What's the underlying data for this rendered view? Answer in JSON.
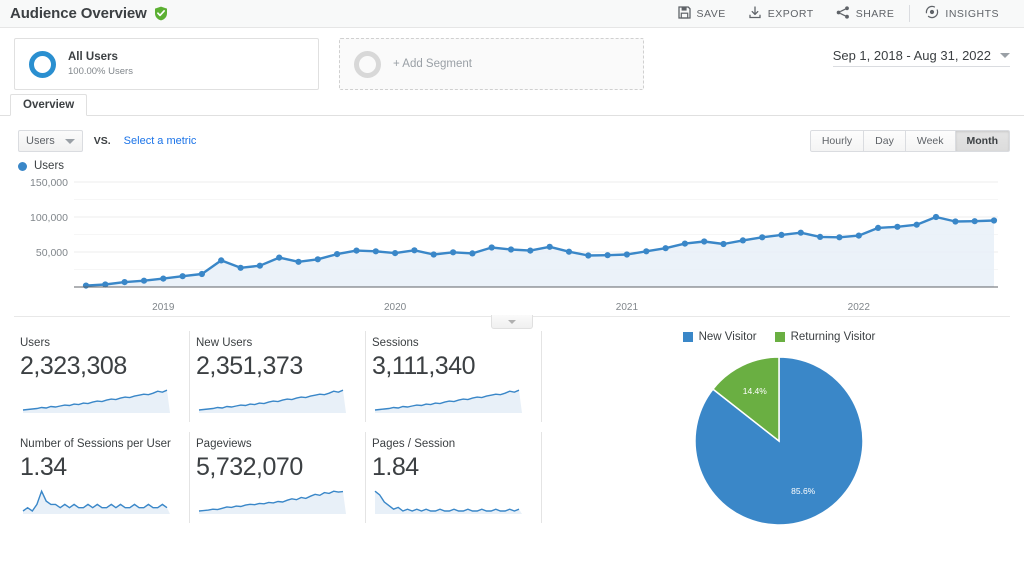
{
  "header": {
    "title": "Audience Overview",
    "verified_icon": "verified-shield-icon",
    "actions": [
      {
        "label": "SAVE",
        "icon": "save-icon"
      },
      {
        "label": "EXPORT",
        "icon": "export-download-icon"
      },
      {
        "label": "SHARE",
        "icon": "share-icon"
      },
      {
        "label": "INSIGHTS",
        "icon": "insights-icon"
      }
    ]
  },
  "segments": {
    "all_users": {
      "name": "All Users",
      "sub": "100.00% Users",
      "icon": "donut-icon"
    },
    "add_segment": {
      "label": "+ Add Segment",
      "icon": "donut-empty-icon"
    }
  },
  "date_range": {
    "value": "Sep 1, 2018 - Aug 31, 2022",
    "icon": "chevron-down-icon"
  },
  "tabs": [
    {
      "label": "Overview",
      "active": true
    }
  ],
  "controls": {
    "metric_select": {
      "value": "Users",
      "icon": "chevron-down-icon"
    },
    "vs_label": "VS.",
    "select_metric_link": "Select a metric",
    "granularity": [
      {
        "label": "Hourly",
        "active": false
      },
      {
        "label": "Day",
        "active": false
      },
      {
        "label": "Week",
        "active": false
      },
      {
        "label": "Month",
        "active": true
      }
    ]
  },
  "colors": {
    "blue": "#3a87c8",
    "green": "#6aaf42",
    "area_fill": "#e8f0f8",
    "link": "#1a73e8"
  },
  "chart_data": {
    "type": "line",
    "title": "Users",
    "legend": [
      "Users"
    ],
    "legend_position": "top-left",
    "xlabel": "",
    "ylabel": "",
    "ylim": [
      0,
      150000
    ],
    "yticks": [
      50000,
      100000,
      150000
    ],
    "ytick_labels": [
      "50,000",
      "100,000",
      "150,000"
    ],
    "grid": true,
    "xtick_labels": [
      "2019",
      "2020",
      "2021",
      "2022"
    ],
    "xtick_indices": [
      4,
      16,
      28,
      40
    ],
    "x": [
      "Sep 2018",
      "Oct 2018",
      "Nov 2018",
      "Dec 2018",
      "Jan 2019",
      "Feb 2019",
      "Mar 2019",
      "Apr 2019",
      "May 2019",
      "Jun 2019",
      "Jul 2019",
      "Aug 2019",
      "Sep 2019",
      "Oct 2019",
      "Nov 2019",
      "Dec 2019",
      "Jan 2020",
      "Feb 2020",
      "Mar 2020",
      "Apr 2020",
      "May 2020",
      "Jun 2020",
      "Jul 2020",
      "Aug 2020",
      "Sep 2020",
      "Oct 2020",
      "Nov 2020",
      "Dec 2020",
      "Jan 2021",
      "Feb 2021",
      "Mar 2021",
      "Apr 2021",
      "May 2021",
      "Jun 2021",
      "Jul 2021",
      "Aug 2021",
      "Sep 2021",
      "Oct 2021",
      "Nov 2021",
      "Dec 2021",
      "Jan 2022",
      "Feb 2022",
      "Mar 2022",
      "Apr 2022",
      "May 2022",
      "Jun 2022",
      "Jul 2022",
      "Aug 2022"
    ],
    "series": [
      {
        "name": "Users",
        "color": "#3a87c8",
        "values": [
          2000,
          3500,
          7000,
          9000,
          12000,
          15500,
          18500,
          38000,
          27500,
          30500,
          42000,
          36000,
          39500,
          47000,
          52000,
          51000,
          48500,
          52500,
          46500,
          49500,
          48000,
          56500,
          53500,
          52000,
          57500,
          50500,
          45000,
          45500,
          46500,
          51000,
          55500,
          62000,
          65000,
          61500,
          66500,
          71000,
          74500,
          77500,
          71500,
          71000,
          73500,
          84500,
          86000,
          89000,
          100000,
          93500,
          94000,
          95000
        ]
      }
    ]
  },
  "metric_cards": [
    {
      "label": "Users",
      "value": "2,323,308",
      "sparkline": "rising"
    },
    {
      "label": "New Users",
      "value": "2,351,373",
      "sparkline": "rising"
    },
    {
      "label": "Sessions",
      "value": "3,111,340",
      "sparkline": "rising"
    },
    {
      "label": "Number of Sessions per User",
      "value": "1.34",
      "sparkline": "flat"
    },
    {
      "label": "Pageviews",
      "value": "5,732,070",
      "sparkline": "rising"
    },
    {
      "label": "Pages / Session",
      "value": "1.84",
      "sparkline": "declining-flat"
    }
  ],
  "pie_chart": {
    "type": "pie",
    "title": "",
    "legend_position": "top",
    "labels": [
      "New Visitor",
      "Returning Visitor"
    ],
    "values": [
      85.6,
      14.4
    ],
    "value_labels": [
      "85.6%",
      "14.4%"
    ],
    "colors": [
      "#3a87c8",
      "#6aaf42"
    ]
  }
}
